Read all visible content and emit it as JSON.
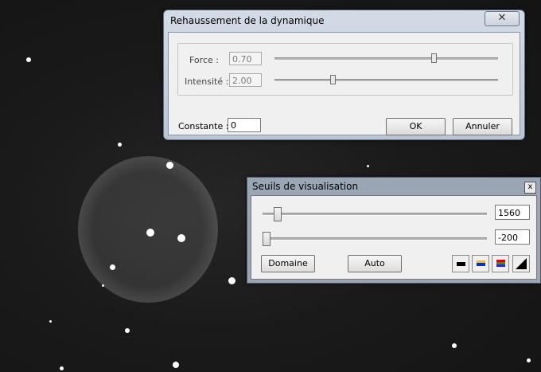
{
  "background": {
    "description_color": "#1b1b1b"
  },
  "dialog_dynamics": {
    "title": "Rehaussement de la dynamique",
    "close_glyph": "✕",
    "force": {
      "label": "Force :",
      "value": "0.70",
      "slider_fraction": 0.71
    },
    "intensite": {
      "label": "Intensité :",
      "value": "2.00",
      "slider_fraction": 0.26
    },
    "constante": {
      "label": "Constante :",
      "value": "0"
    },
    "ok_label": "OK",
    "cancel_label": "Annuler"
  },
  "dialog_thresholds": {
    "title": "Seuils de visualisation",
    "close_glyph": "x",
    "high": {
      "value": "1560",
      "slider_fraction": 0.05
    },
    "low": {
      "value": "-200",
      "slider_fraction": 0.0
    },
    "domain_label": "Domaine",
    "auto_label": "Auto",
    "palette_buttons": [
      {
        "name": "palette-mono-icon",
        "colors": [
          "#000000"
        ]
      },
      {
        "name": "palette-blue-yellow-icon",
        "colors": [
          "#f2c200",
          "#0033cc"
        ]
      },
      {
        "name": "palette-rainbow-icon",
        "colors": [
          "#e00000",
          "#1a9e1a",
          "#2a2ad0"
        ]
      },
      {
        "name": "palette-gradient-icon",
        "colors": [
          "#000000"
        ]
      }
    ]
  }
}
